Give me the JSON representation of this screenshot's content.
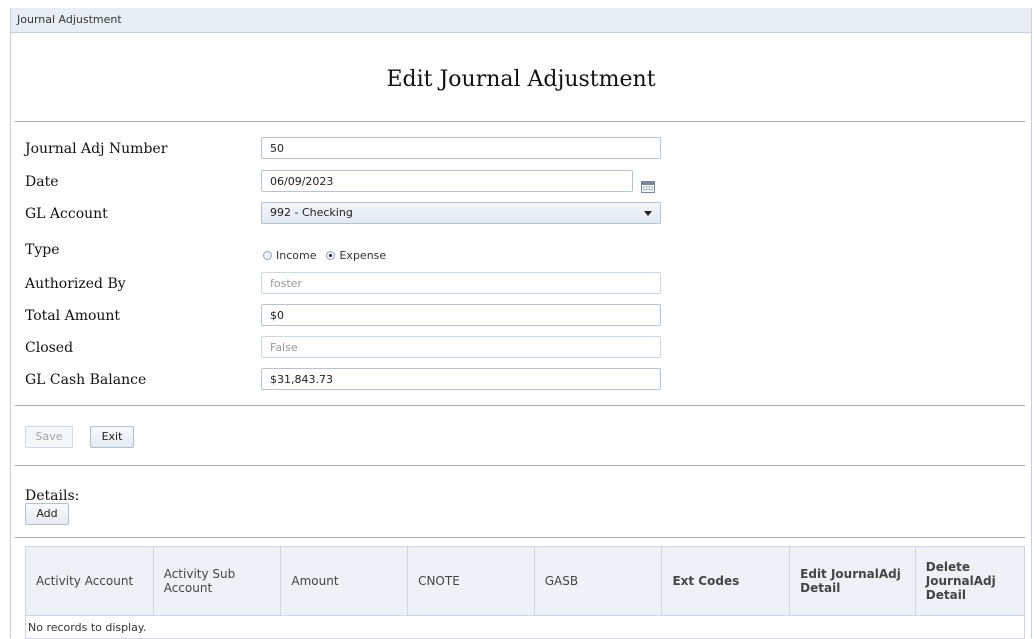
{
  "window": {
    "title": "Journal Adjustment"
  },
  "page": {
    "title": "Edit Journal Adjustment"
  },
  "form": {
    "journal_adj_number": {
      "label": "Journal Adj Number",
      "value": "50"
    },
    "date": {
      "label": "Date",
      "value": "06/09/2023"
    },
    "gl_account": {
      "label": "GL Account",
      "value": "992 - Checking"
    },
    "type": {
      "label": "Type",
      "options": [
        {
          "label": "Income",
          "checked": false
        },
        {
          "label": "Expense",
          "checked": true
        }
      ]
    },
    "authorized_by": {
      "label": "Authorized By",
      "value": "foster"
    },
    "total_amount": {
      "label": "Total Amount",
      "value": "$0"
    },
    "closed": {
      "label": "Closed",
      "value": "False"
    },
    "gl_cash_balance": {
      "label": "GL Cash Balance",
      "value": "$31,843.73"
    }
  },
  "actions": {
    "save_label": "Save",
    "exit_label": "Exit"
  },
  "details": {
    "label": "Details:",
    "add_label": "Add",
    "columns": [
      "Activity Account",
      "Activity Sub Account",
      "Amount",
      "CNOTE",
      "GASB",
      "Ext Codes",
      "Edit JournalAdj Detail",
      "Delete JournalAdj Detail"
    ],
    "empty_message": "No records to display."
  }
}
